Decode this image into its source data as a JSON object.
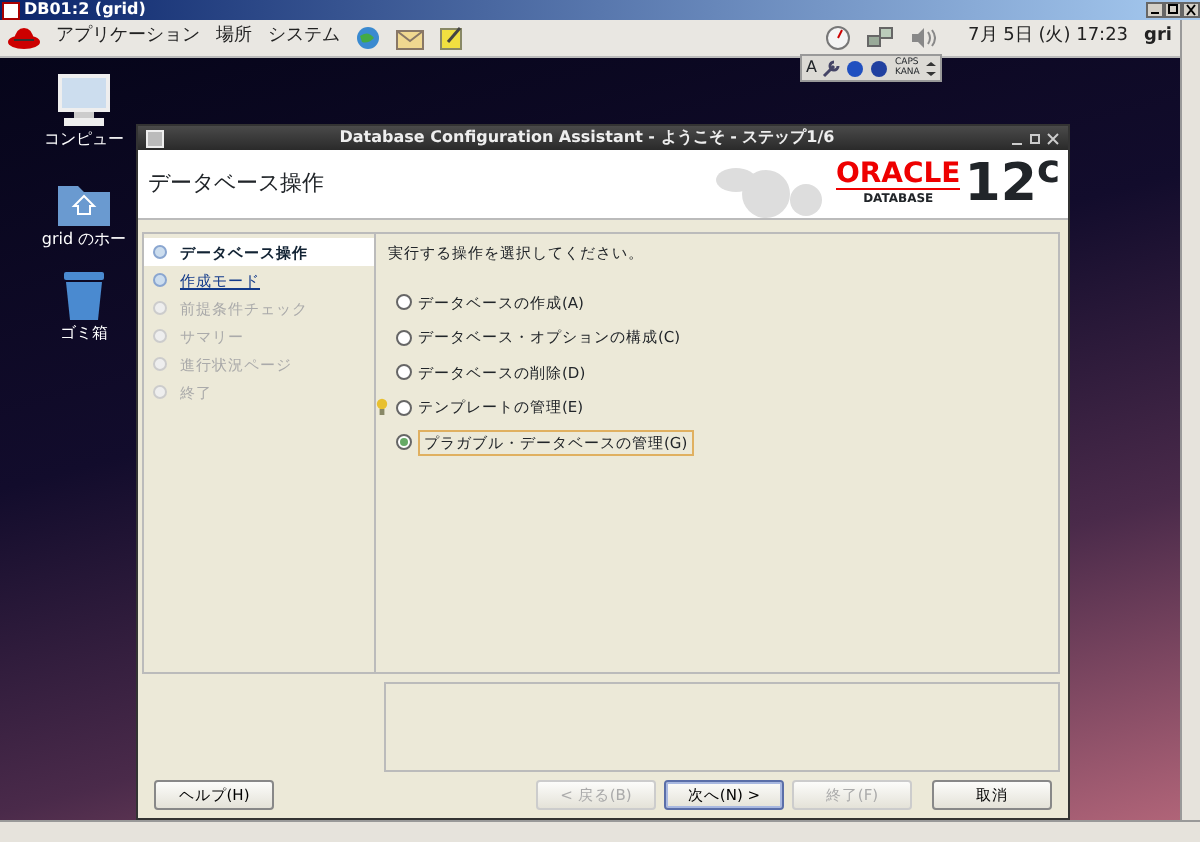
{
  "vnc_window": {
    "title": "DB01:2 (grid)"
  },
  "panel": {
    "menus": [
      "アプリケーション",
      "場所",
      "システム"
    ],
    "clock": "7月 5日 (火) 17:23",
    "user": "gri"
  },
  "input_toolbar": {
    "letter": "A",
    "caps": "CAPS",
    "kana": "KANA"
  },
  "desktop_icons": [
    {
      "label": "コンピュー",
      "kind": "computer"
    },
    {
      "label": "grid のホー",
      "kind": "home"
    },
    {
      "label": "ゴミ箱",
      "kind": "trash"
    }
  ],
  "dialog": {
    "title": "Database Configuration Assistant - ようこそ - ステップ1/6",
    "header": "データベース操作",
    "logo": {
      "brand": "ORACLE",
      "product": "DATABASE",
      "version": "12$^{c}$"
    },
    "steps": [
      {
        "label": "データベース操作",
        "selected": true,
        "disabled": false
      },
      {
        "label": "作成モード",
        "selected": false,
        "disabled": false
      },
      {
        "label": "前提条件チェック",
        "selected": false,
        "disabled": true
      },
      {
        "label": "サマリー",
        "selected": false,
        "disabled": true
      },
      {
        "label": "進行状況ページ",
        "selected": false,
        "disabled": true
      },
      {
        "label": "終了",
        "selected": false,
        "disabled": true
      }
    ],
    "prompt": "実行する操作を選択してください。",
    "options": [
      {
        "label": "データベースの作成(A)",
        "selected": false,
        "hint": false
      },
      {
        "label": "データベース・オプションの構成(C)",
        "selected": false,
        "hint": false
      },
      {
        "label": "データベースの削除(D)",
        "selected": false,
        "hint": false
      },
      {
        "label": "テンプレートの管理(E)",
        "selected": false,
        "hint": true
      },
      {
        "label": "プラガブル・データベースの管理(G)",
        "selected": true,
        "hint": false
      }
    ],
    "buttons": [
      {
        "label": "ヘルプ(H)",
        "disabled": false,
        "default": false
      },
      {
        "label": "< 戻る(B)",
        "disabled": true,
        "default": false
      },
      {
        "label": "次へ(N) >",
        "disabled": false,
        "default": true
      },
      {
        "label": "終了(F)",
        "disabled": true,
        "default": false
      },
      {
        "label": "取消",
        "disabled": false,
        "default": false
      }
    ]
  }
}
